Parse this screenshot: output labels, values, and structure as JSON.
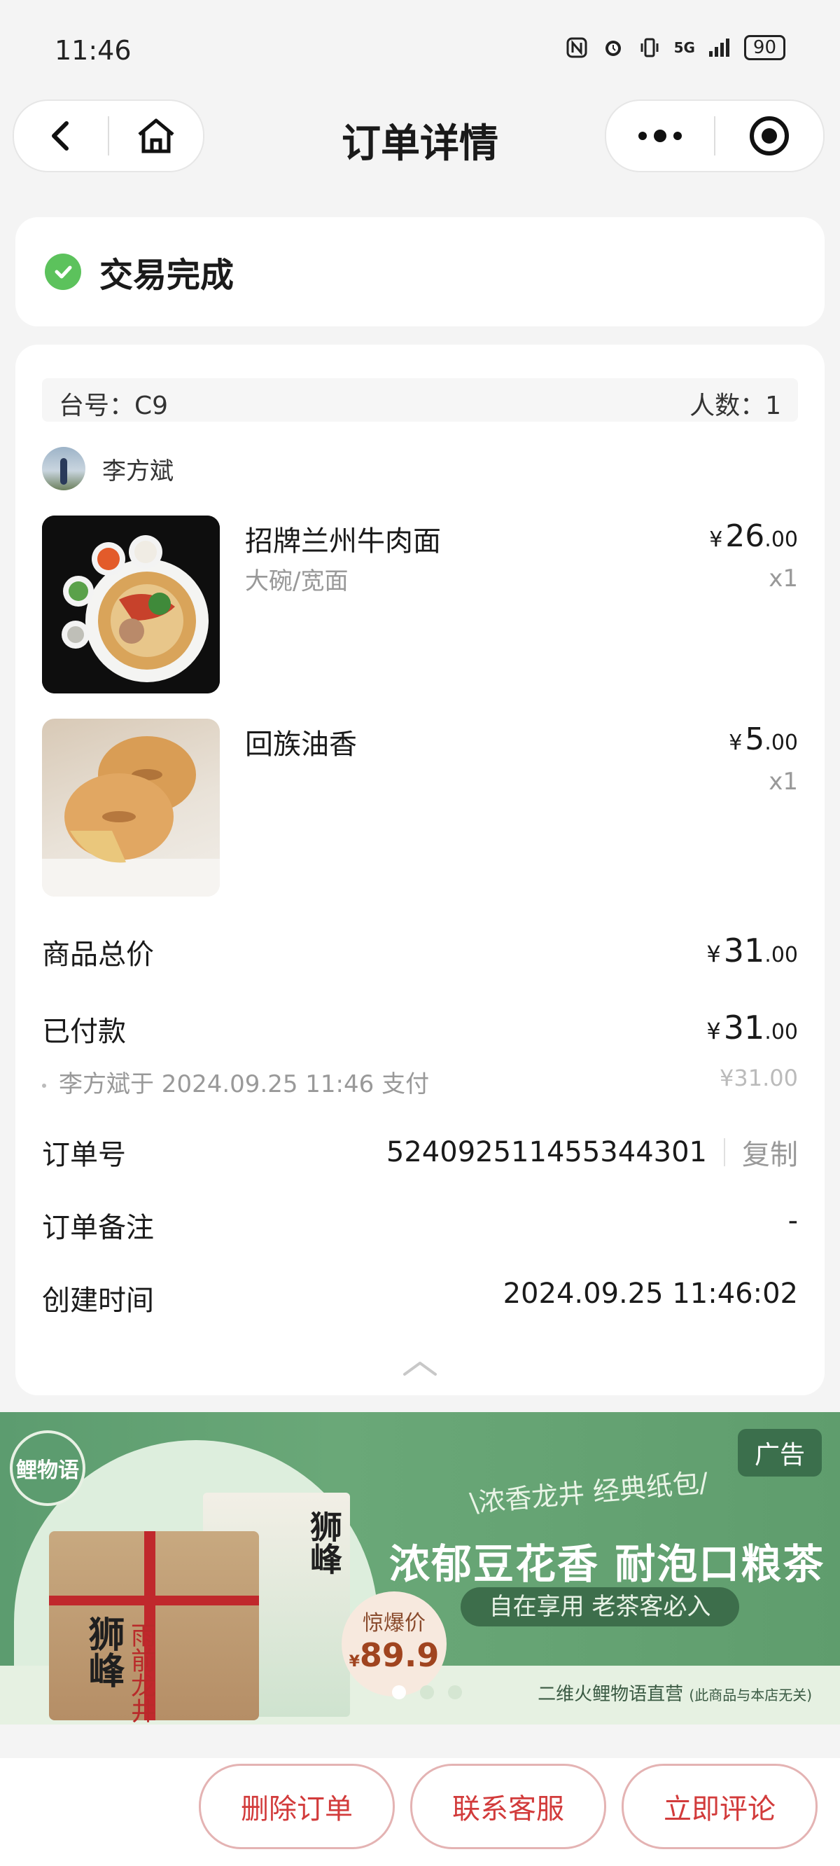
{
  "status_bar": {
    "time": "11:46",
    "network": "5G",
    "battery": "90"
  },
  "nav": {
    "title": "订单详情"
  },
  "order_status": {
    "text": "交易完成"
  },
  "order": {
    "table_label": "台号：C9",
    "people_label": "人数：1",
    "user_name": "李方斌",
    "items": [
      {
        "name": "招牌兰州牛肉面",
        "spec": "大碗/宽面",
        "currency": "¥",
        "price_int": "26",
        "price_dec": ".00",
        "qty": "x1"
      },
      {
        "name": "回族油香",
        "spec": "",
        "currency": "¥",
        "price_int": "5",
        "price_dec": ".00",
        "qty": "x1"
      }
    ],
    "total": {
      "label": "商品总价",
      "currency": "¥",
      "int": "31",
      "dec": ".00"
    },
    "paid": {
      "label": "已付款",
      "currency": "¥",
      "int": "31",
      "dec": ".00"
    },
    "payment_note": "李方斌于 2024.09.25 11:46 支付",
    "payment_note_amount": "¥31.00",
    "order_no": {
      "label": "订单号",
      "value": "524092511455344301",
      "copy": "复制"
    },
    "remark": {
      "label": "订单备注",
      "value": "-"
    },
    "created": {
      "label": "创建时间",
      "value": "2024.09.25 11:46:02"
    }
  },
  "ad": {
    "tag": "广告",
    "logo": "鲤物语",
    "subtitle": "\\浓香龙井  经典纸包/",
    "headline": "浓郁豆花香 耐泡口粮茶",
    "pill": "自在享用 老茶客必入",
    "price_label": "惊爆价",
    "price_currency": "¥",
    "price_value": "89.9",
    "seller": "二维火鲤物语直营",
    "seller_note": "(此商品与本店无关)",
    "pack_text_1": "狮峰",
    "pack_text_2": "雨前龙井",
    "pack_text_3": "狮峰"
  },
  "actions": {
    "delete": "删除订单",
    "contact": "联系客服",
    "review": "立即评论"
  },
  "colors": {
    "accent_red": "#d23b3b",
    "success_green": "#5cc25c",
    "ad_green": "#5c9c6f"
  }
}
